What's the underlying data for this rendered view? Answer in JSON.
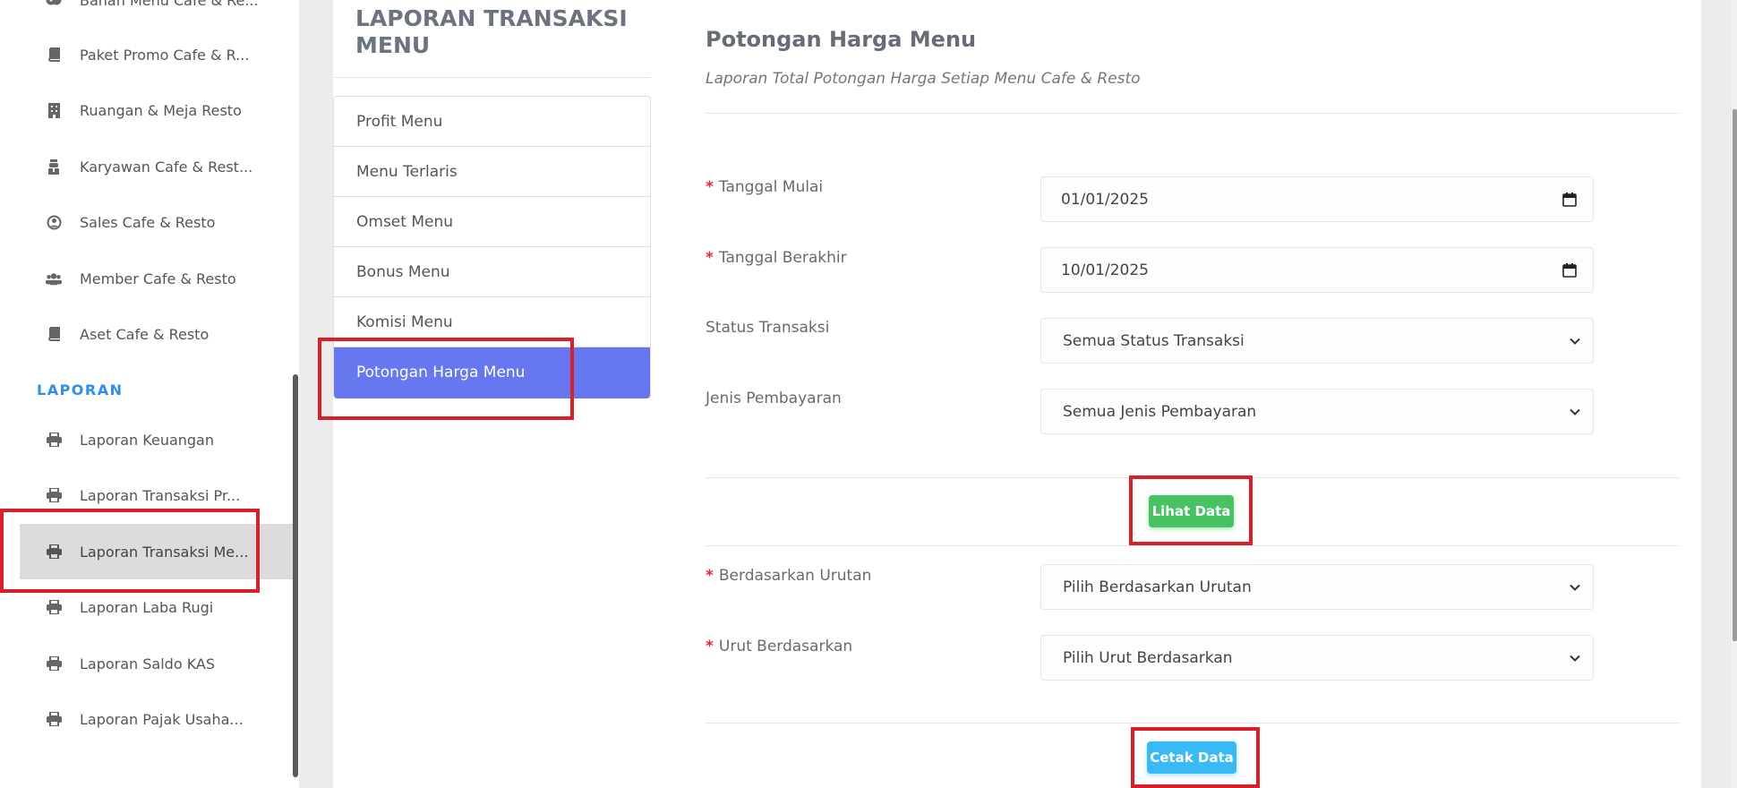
{
  "sidebar": {
    "items_top": [
      {
        "label": "Bahan Menu Cafe & Re...",
        "icon": "cookie-bite-icon"
      },
      {
        "label": "Paket Promo Cafe & R...",
        "icon": "book-icon"
      },
      {
        "label": "Ruangan & Meja Resto",
        "icon": "building-icon"
      },
      {
        "label": "Karyawan Cafe & Rest...",
        "icon": "user-tie-icon"
      },
      {
        "label": "Sales Cafe & Resto",
        "icon": "user-circle-icon"
      },
      {
        "label": "Member Cafe & Resto",
        "icon": "users-icon"
      },
      {
        "label": "Aset Cafe & Resto",
        "icon": "book-icon"
      }
    ],
    "section": "LAPORAN",
    "items_laporan": [
      {
        "label": "Laporan Keuangan",
        "icon": "print-icon"
      },
      {
        "label": "Laporan Transaksi Pr...",
        "icon": "print-icon"
      },
      {
        "label": "Laporan Transaksi Me...",
        "icon": "print-icon"
      },
      {
        "label": "Laporan Laba Rugi",
        "icon": "print-icon"
      },
      {
        "label": "Laporan Saldo KAS",
        "icon": "print-icon"
      },
      {
        "label": "Laporan Pajak Usaha...",
        "icon": "print-icon"
      }
    ]
  },
  "left_panel": {
    "title": "LAPORAN TRANSAKSI MENU",
    "menu": [
      "Profit Menu",
      "Menu Terlaris",
      "Omset Menu",
      "Bonus Menu",
      "Komisi Menu",
      "Potongan Harga Menu"
    ]
  },
  "main": {
    "title": "Potongan Harga Menu",
    "subtitle": "Laporan Total Potongan Harga Setiap Menu Cafe & Resto",
    "required_mark": "*",
    "tanggal_mulai": {
      "label": "Tanggal Mulai",
      "value": "01/01/2025"
    },
    "tanggal_berakhir": {
      "label": "Tanggal Berakhir",
      "value": "10/01/2025"
    },
    "status_transaksi": {
      "label": "Status Transaksi",
      "value": "Semua Status Transaksi"
    },
    "jenis_pembayaran": {
      "label": "Jenis Pembayaran",
      "value": "Semua Jenis Pembayaran"
    },
    "lihat_data": "Lihat Data",
    "berdasarkan_urutan": {
      "label": "Berdasarkan Urutan",
      "value": "Pilih Berdasarkan Urutan"
    },
    "urut_berdasarkan": {
      "label": "Urut Berdasarkan",
      "value": "Pilih Urut Berdasarkan"
    },
    "cetak_data": "Cetak Data"
  },
  "colors": {
    "active_menu": "#6777ef",
    "section_label": "#2f8fe8",
    "button_green": "#47c363",
    "button_blue": "#3abaf4",
    "highlight": "#d8202a",
    "required": "#e3283b"
  }
}
